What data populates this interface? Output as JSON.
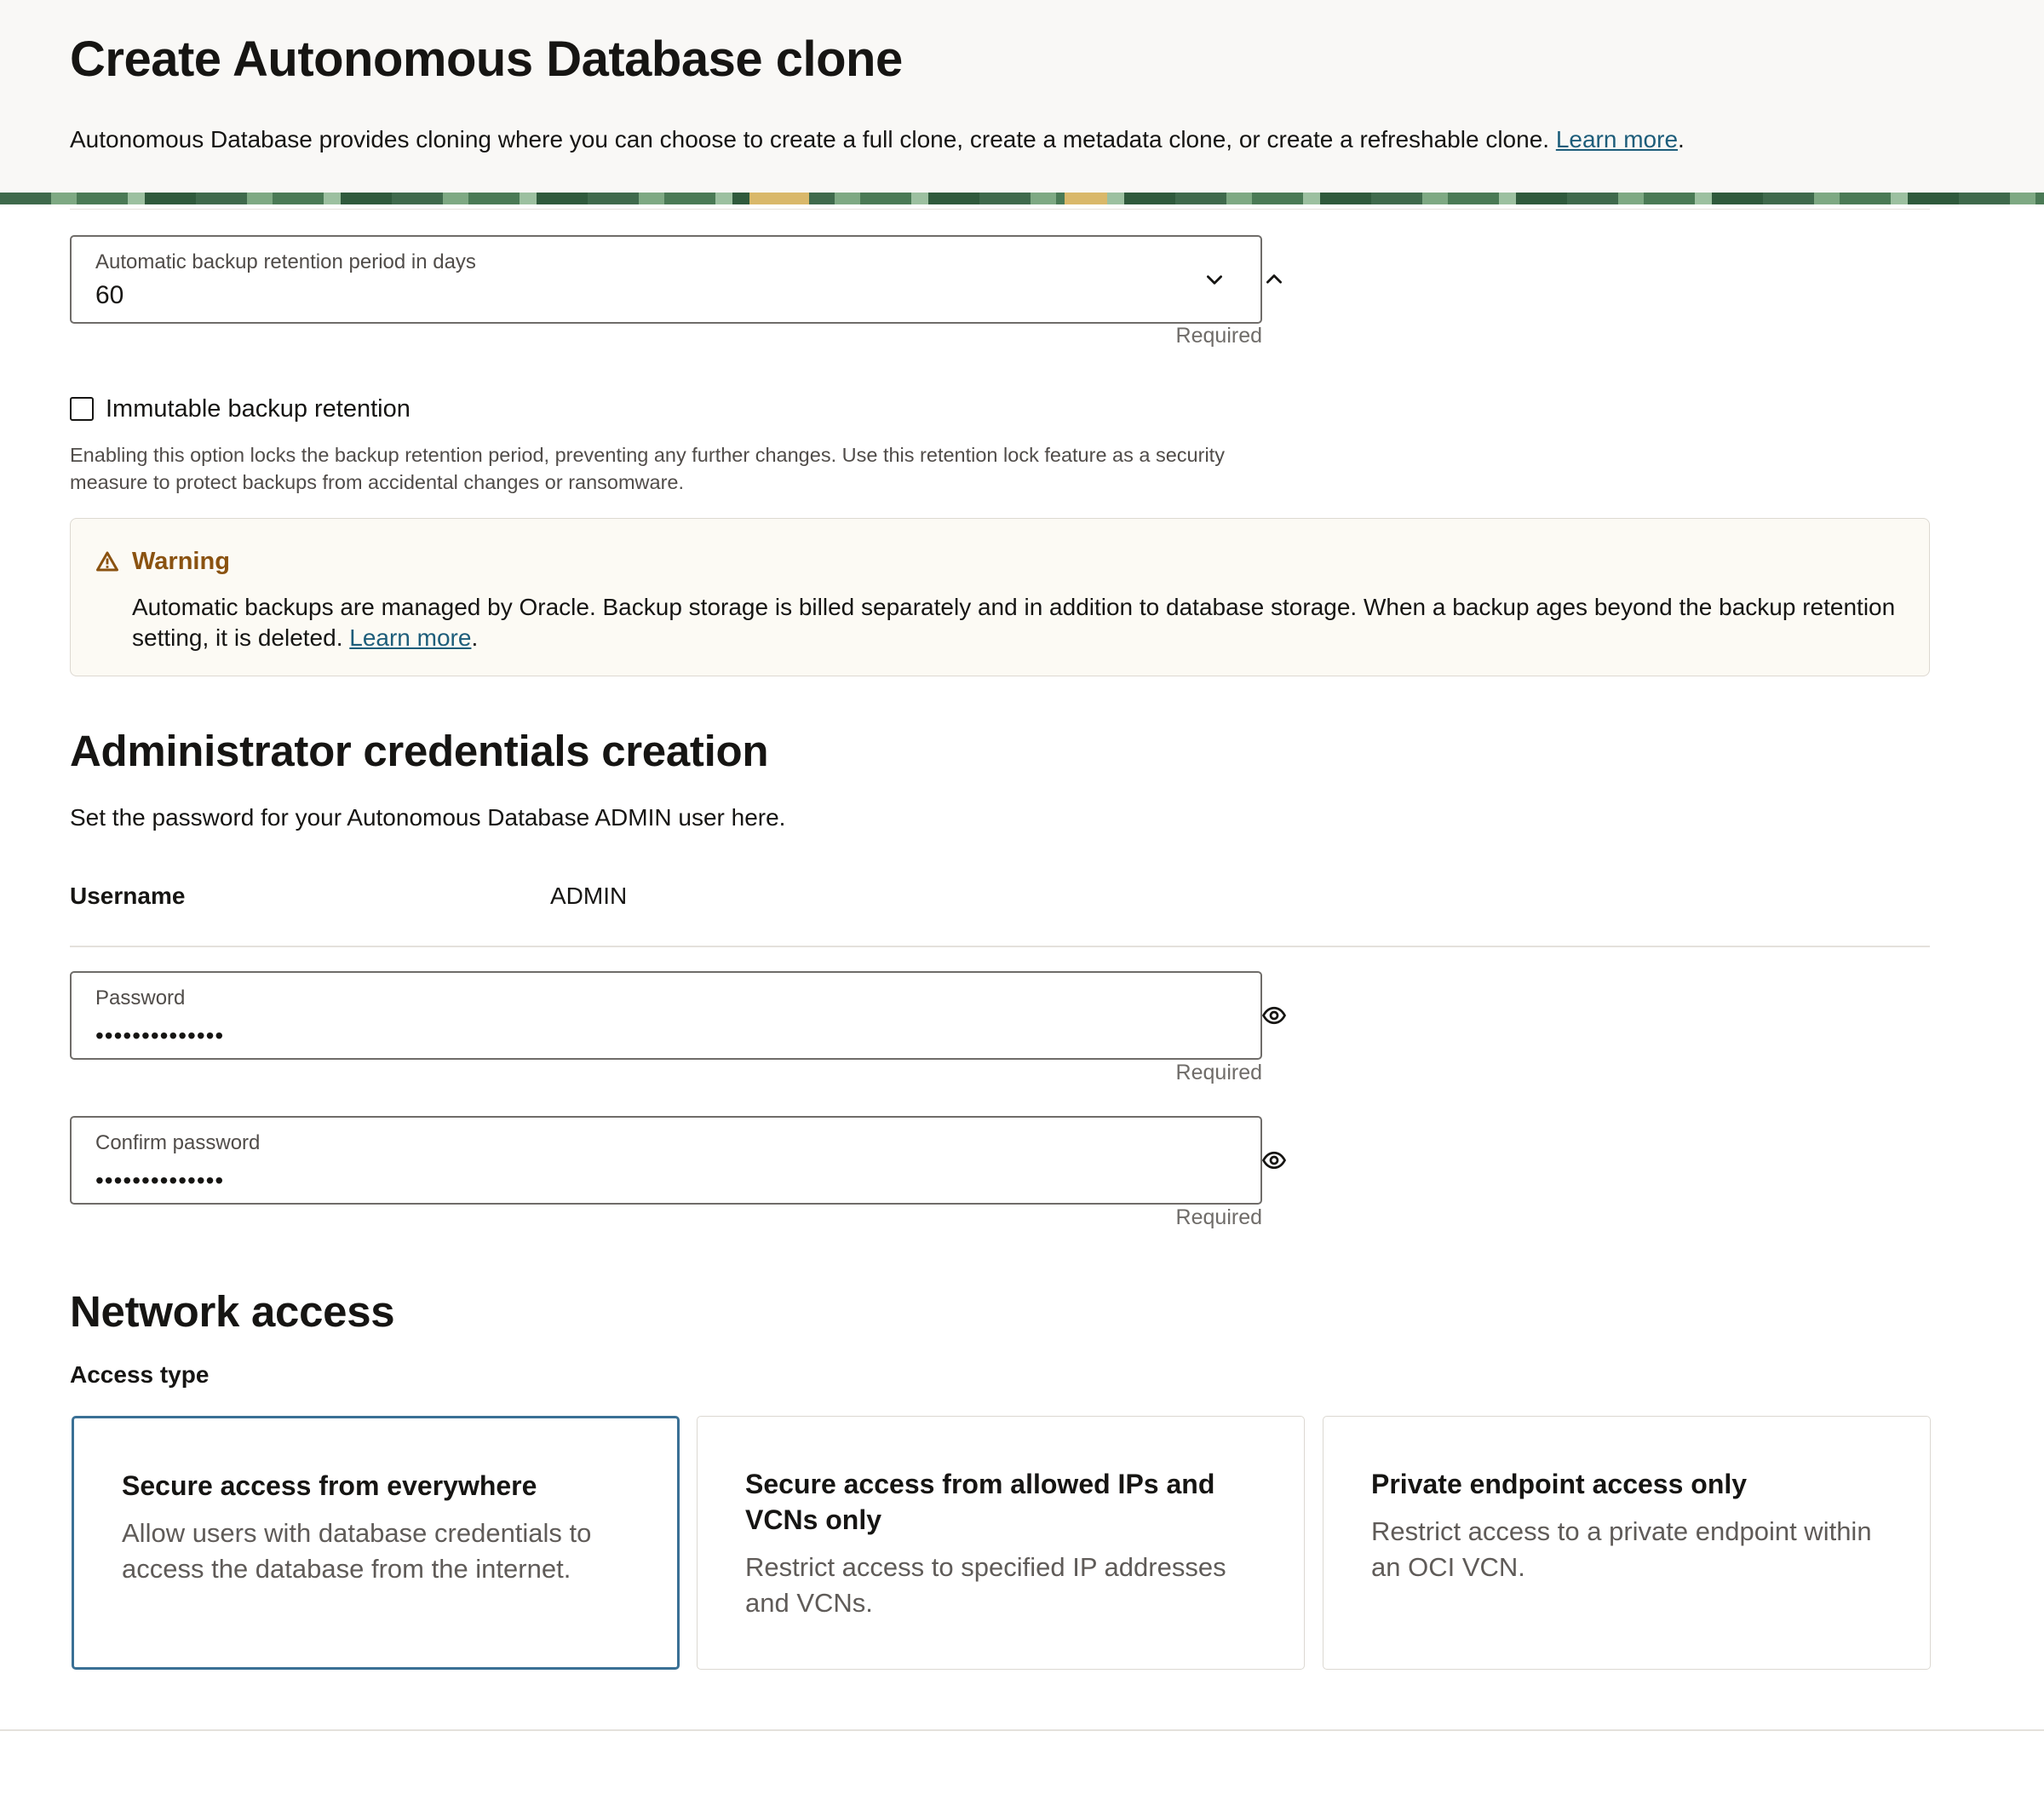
{
  "header": {
    "title": "Create Autonomous Database clone",
    "description": "Autonomous Database provides cloning where you can choose to create a full clone, create a metadata clone, or create a refreshable clone.",
    "learn_more": "Learn more",
    "period": "."
  },
  "backup": {
    "retention_label": "Automatic backup retention period in days",
    "retention_value": "60",
    "required": "Required",
    "immutable_label": "Immutable backup retention",
    "immutable_checked": false,
    "immutable_help": "Enabling this option locks the backup retention period, preventing any further changes. Use this retention lock feature as a security measure to protect backups from accidental changes or ransomware."
  },
  "warning": {
    "title": "Warning",
    "text": "Automatic backups are managed by Oracle. Backup storage is billed separately and in addition to database storage. When a backup ages beyond the backup retention setting, it is deleted.",
    "learn_more": "Learn more",
    "period": "."
  },
  "admin": {
    "title": "Administrator credentials creation",
    "description": "Set the password for your Autonomous Database ADMIN user here.",
    "username_label": "Username",
    "username_value": "ADMIN",
    "password_label": "Password",
    "password_mask": "••••••••••••••",
    "confirm_label": "Confirm password",
    "confirm_mask": "••••••••••••••",
    "required": "Required"
  },
  "network": {
    "title": "Network access",
    "access_type_label": "Access type",
    "options": [
      {
        "title": "Secure access from everywhere",
        "description": "Allow users with database credentials to access the database from the internet.",
        "selected": true
      },
      {
        "title": "Secure access from allowed IPs and VCNs only",
        "description": "Restrict access to specified IP addresses and VCNs.",
        "selected": false
      },
      {
        "title": "Private endpoint access only",
        "description": "Restrict access to a private endpoint within an OCI VCN.",
        "selected": false
      }
    ]
  },
  "colors": {
    "link": "#1d5d7a",
    "warning_title": "#8a5210",
    "selected_border": "#3a7095",
    "header_bg": "#f9f8f6"
  },
  "icons": {
    "decrement": "chevron-down-icon",
    "increment": "chevron-up-icon",
    "reveal": "eye-icon",
    "warning": "warning-triangle-icon"
  }
}
